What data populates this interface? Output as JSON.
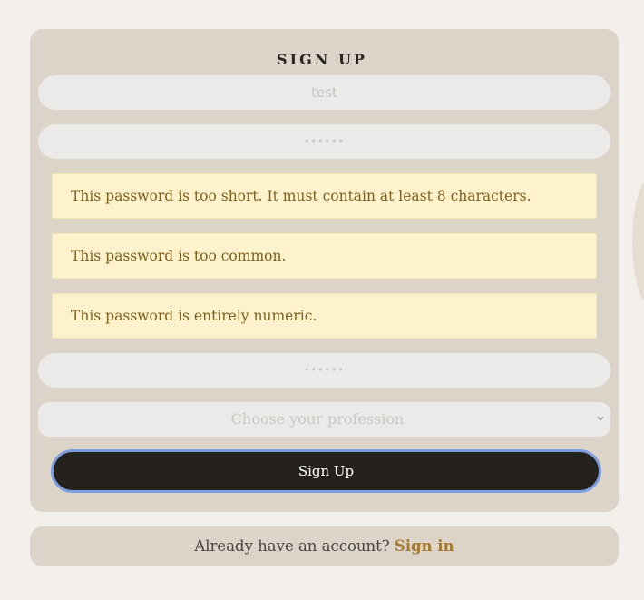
{
  "form": {
    "title": "SIGN UP",
    "username_value": "test",
    "password_value": "••••••",
    "password_confirm_value": "••••••",
    "profession_placeholder": "Choose your profession",
    "submit_label": "Sign Up"
  },
  "errors": [
    "This password is too short. It must contain at least 8 characters.",
    "This password is too common.",
    "This password is entirely numeric."
  ],
  "footer": {
    "prompt": "Already have an account?",
    "link_label": "Sign in"
  },
  "colors": {
    "page_background": "#f3f0eb",
    "card_background": "#dcd3c9",
    "alert_background": "#fdf2cc",
    "alert_text": "#7d5f1c",
    "button_background": "#25211d",
    "link_accent": "#a3782f"
  },
  "icons": {
    "select_chevron": "chevron-down-icon"
  }
}
